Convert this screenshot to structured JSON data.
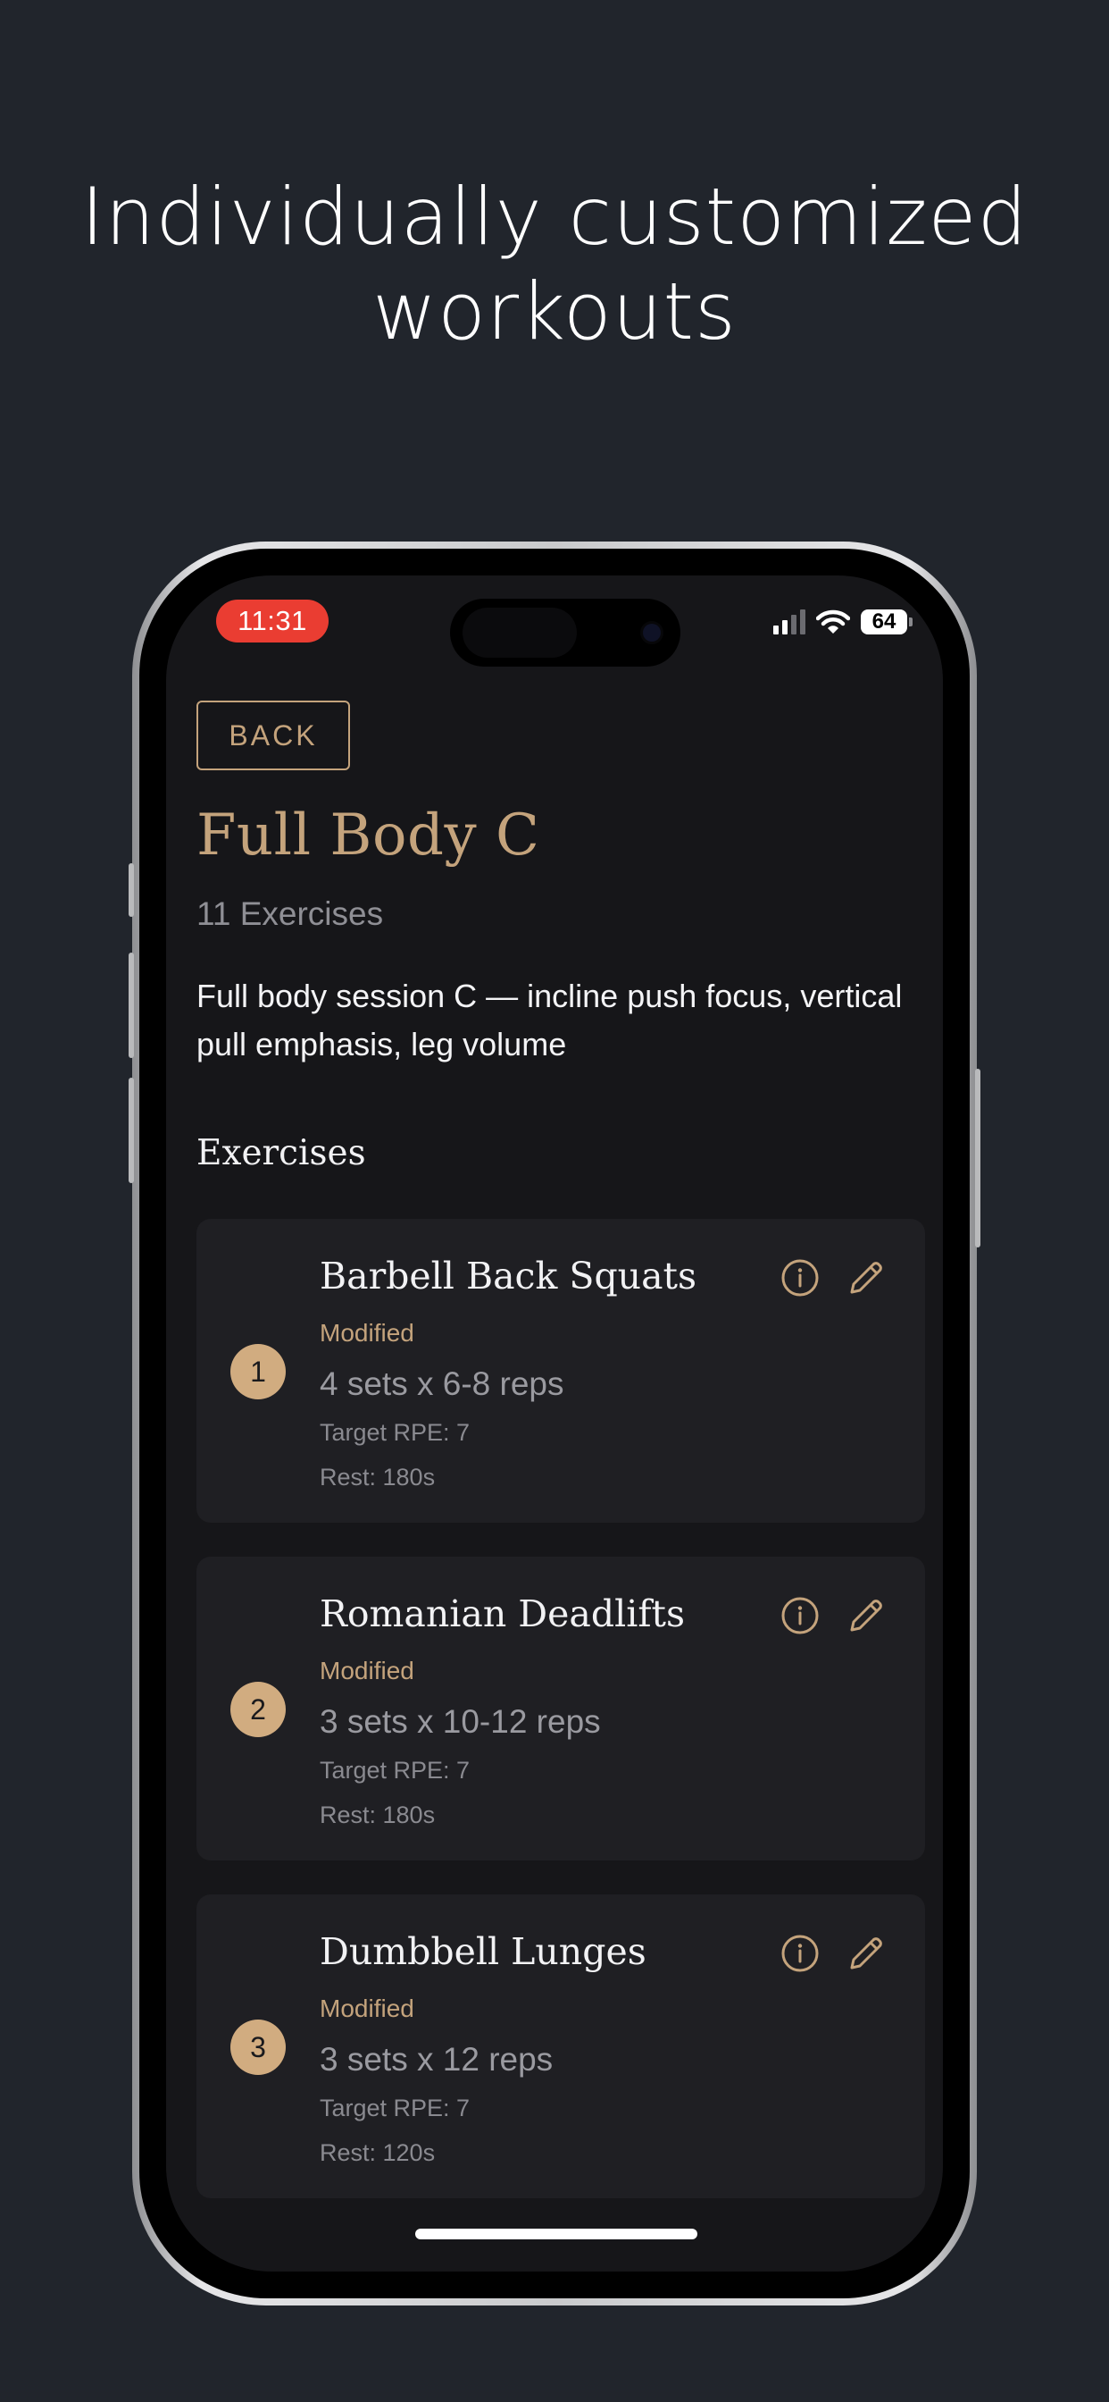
{
  "headline": {
    "line1": "Individually customized",
    "line2": "workouts"
  },
  "status_bar": {
    "time": "11:31",
    "battery": "64"
  },
  "back_label": "BACK",
  "workout": {
    "title": "Full Body C",
    "exercise_count": "11 Exercises",
    "description": "Full body session C — incline push focus, vertical pull emphasis, leg volume"
  },
  "section_title": "Exercises",
  "exercises": [
    {
      "number": "1",
      "name": "Barbell Back Squats",
      "status": "Modified",
      "sets": "4 sets x 6-8 reps",
      "rpe": "Target RPE: 7",
      "rest": "Rest: 180s"
    },
    {
      "number": "2",
      "name": "Romanian Deadlifts",
      "status": "Modified",
      "sets": "3 sets x 10-12 reps",
      "rpe": "Target RPE: 7",
      "rest": "Rest: 180s"
    },
    {
      "number": "3",
      "name": "Dumbbell Lunges",
      "status": "Modified",
      "sets": "3 sets x 12 reps",
      "rpe": "Target RPE: 7",
      "rest": "Rest: 120s"
    }
  ],
  "icons": {
    "info": "info-icon",
    "edit": "pencil-icon"
  },
  "colors": {
    "accent": "#c4a37c",
    "background": "#21252c",
    "screen": "#161619",
    "card": "#1f1f23",
    "recording_pill": "#ea3d32"
  }
}
